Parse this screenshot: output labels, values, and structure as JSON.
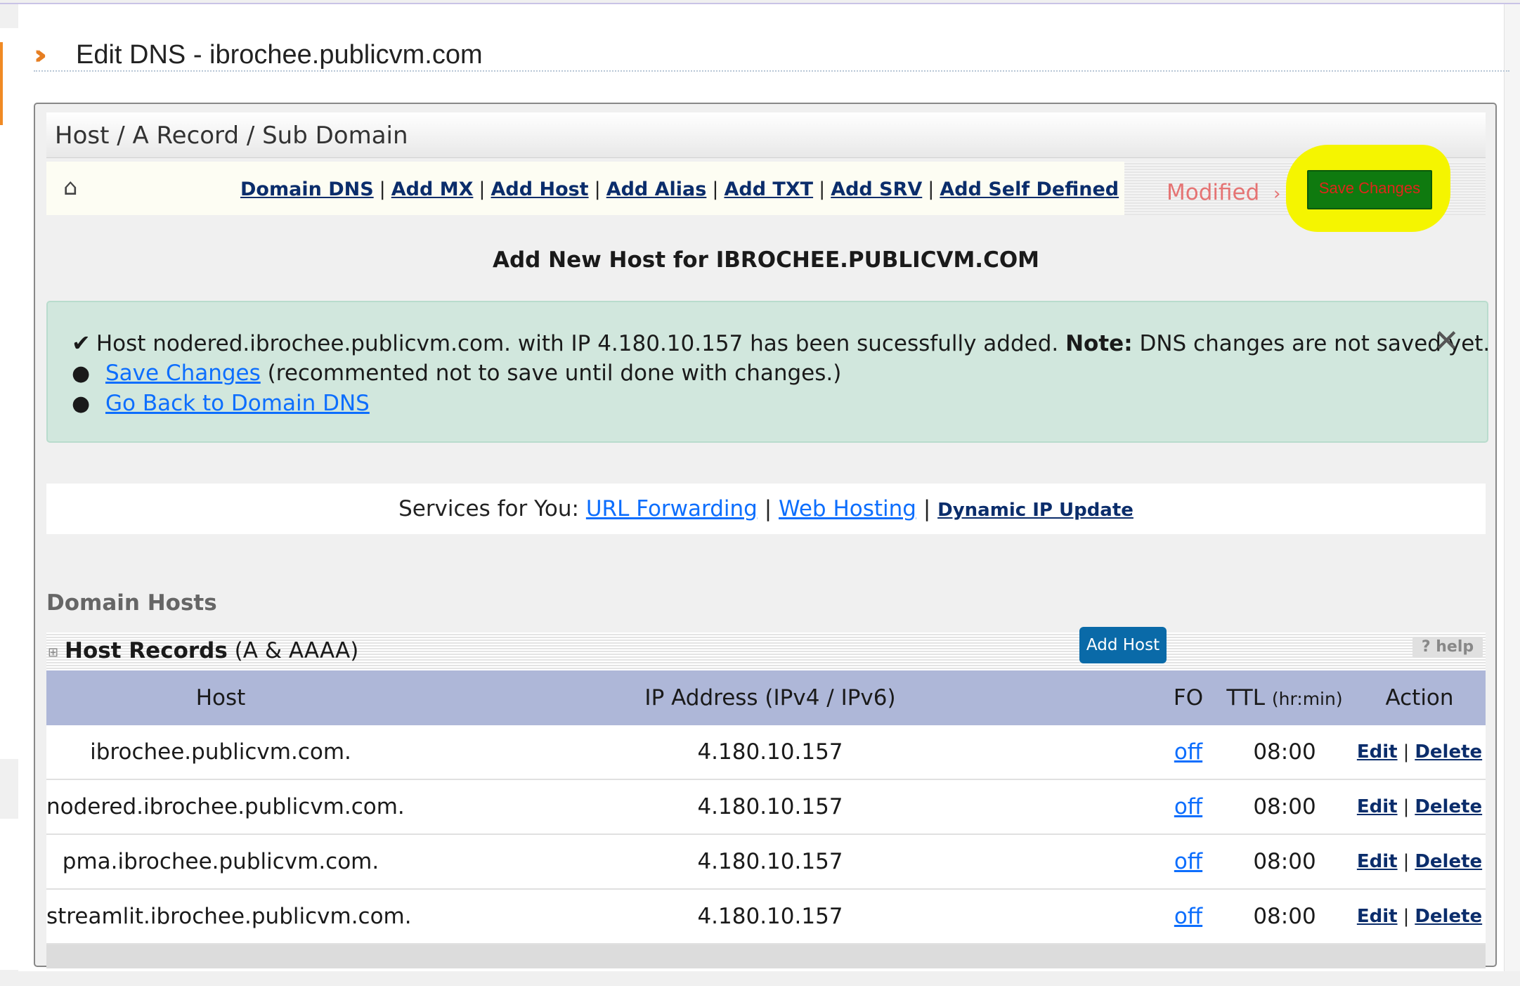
{
  "page": {
    "title": "Edit DNS - ibrochee.publicvm.com"
  },
  "panel": {
    "header": "Host / A Record / Sub Domain",
    "nav": [
      {
        "label": "Domain DNS"
      },
      {
        "label": "Add MX"
      },
      {
        "label": "Add Host"
      },
      {
        "label": "Add Alias"
      },
      {
        "label": "Add TXT"
      },
      {
        "label": "Add SRV"
      },
      {
        "label": "Add Self Defined"
      }
    ],
    "modified_label": "Modified",
    "save_button": "Save Changes",
    "highlight_color": "#f5f500"
  },
  "add_new_title": "Add New Host for IBROCHEE.PUBLICVM.COM",
  "alert": {
    "message_prefix": "Host nodered.ibrochee.publicvm.com. with IP 4.180.10.157 has been sucessfully added.",
    "note_label": "Note:",
    "note_text": "DNS changes are not saved yet.",
    "save_link": "Save Changes",
    "save_hint": "(recommented not to save until done with changes.)",
    "back_link": "Go Back to Domain DNS",
    "close_icon": "close-icon"
  },
  "services": {
    "prefix": "Services for You:",
    "links": [
      "URL Forwarding",
      "Web Hosting",
      "Dynamic IP Update"
    ]
  },
  "domain_hosts_label": "Domain Hosts",
  "host_records": {
    "title_bold": "Host Records",
    "title_rest": "(A & AAAA)",
    "add_button": "Add Host",
    "help": "help",
    "columns": {
      "host": "Host",
      "ip": "IP Address (IPv4 / IPv6)",
      "fo": "FO",
      "ttl": "TTL",
      "ttl_unit": "(hr:min)",
      "action": "Action"
    },
    "rows": [
      {
        "host": "ibrochee.publicvm.com.",
        "ip": "4.180.10.157",
        "fo": "off",
        "ttl": "08:00",
        "edit": "Edit",
        "delete": "Delete"
      },
      {
        "host": "nodered.ibrochee.publicvm.com.",
        "ip": "4.180.10.157",
        "fo": "off",
        "ttl": "08:00",
        "edit": "Edit",
        "delete": "Delete"
      },
      {
        "host": "pma.ibrochee.publicvm.com.",
        "ip": "4.180.10.157",
        "fo": "off",
        "ttl": "08:00",
        "edit": "Edit",
        "delete": "Delete"
      },
      {
        "host": "streamlit.ibrochee.publicvm.com.",
        "ip": "4.180.10.157",
        "fo": "off",
        "ttl": "08:00",
        "edit": "Edit",
        "delete": "Delete"
      }
    ]
  },
  "colors": {
    "accent_orange": "#f08a24",
    "table_header": "#aeb7d8",
    "alert_bg": "#d1e7dd",
    "save_btn_bg": "#0f7a0f",
    "save_btn_text": "#e0261b",
    "link_blue": "#0d6efd",
    "nav_link": "#0b2d6b"
  }
}
